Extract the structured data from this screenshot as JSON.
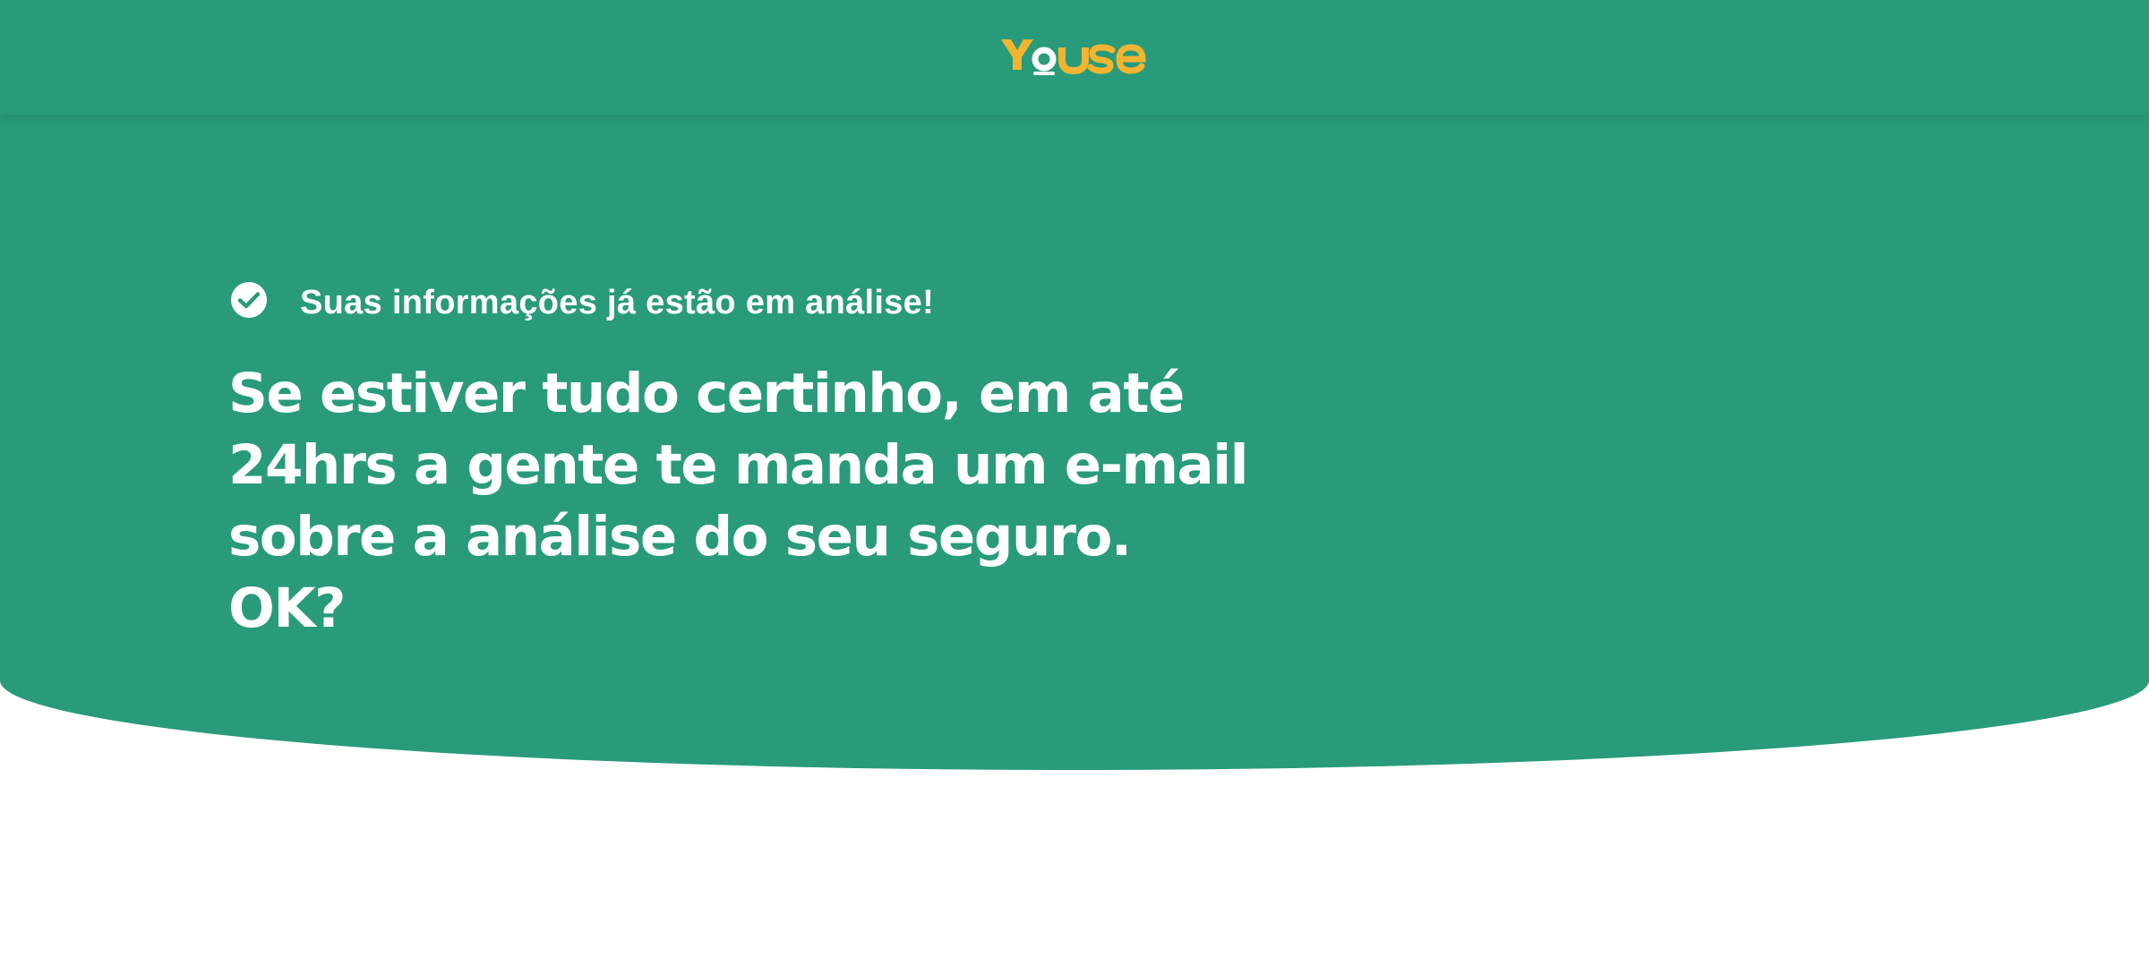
{
  "header": {
    "logo_text": "YOUSE",
    "logo_colors": {
      "brand_yellow": "#f2b531",
      "white": "#ffffff"
    }
  },
  "hero": {
    "status_icon": "check-circle-icon",
    "status_text": "Suas informações já estão em análise!",
    "headline": "Se estiver tudo certinho, em até 24hrs a gente te manda um e-mail sobre a análise do seu seguro. OK?"
  },
  "colors": {
    "background_green": "#299b7b",
    "text": "#ffffff",
    "page_background": "#ffffff"
  }
}
